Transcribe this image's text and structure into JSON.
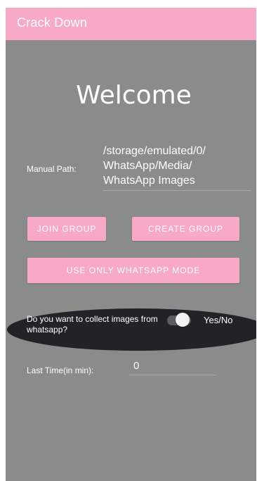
{
  "app": {
    "title": "Crack Down",
    "accent_color": "#f8a9c7",
    "background_color": "#8a8c8c"
  },
  "main": {
    "heading": "Welcome",
    "manual_path_label": "Manual Path:",
    "manual_path_value": "/storage/emulated/0/\nWhatsApp/Media/\nWhatsApp Images",
    "join_group_label": "JOIN GROUP",
    "create_group_label": "CREATE GROUP",
    "whatsapp_mode_label": "USE ONLY WHATSAPP MODE",
    "collect_question": "Do you want to collect images from whatsapp?",
    "toggle_label": "Yes/No",
    "toggle_on": true,
    "last_time_label": "Last Time(in min):",
    "last_time_value": "0"
  }
}
